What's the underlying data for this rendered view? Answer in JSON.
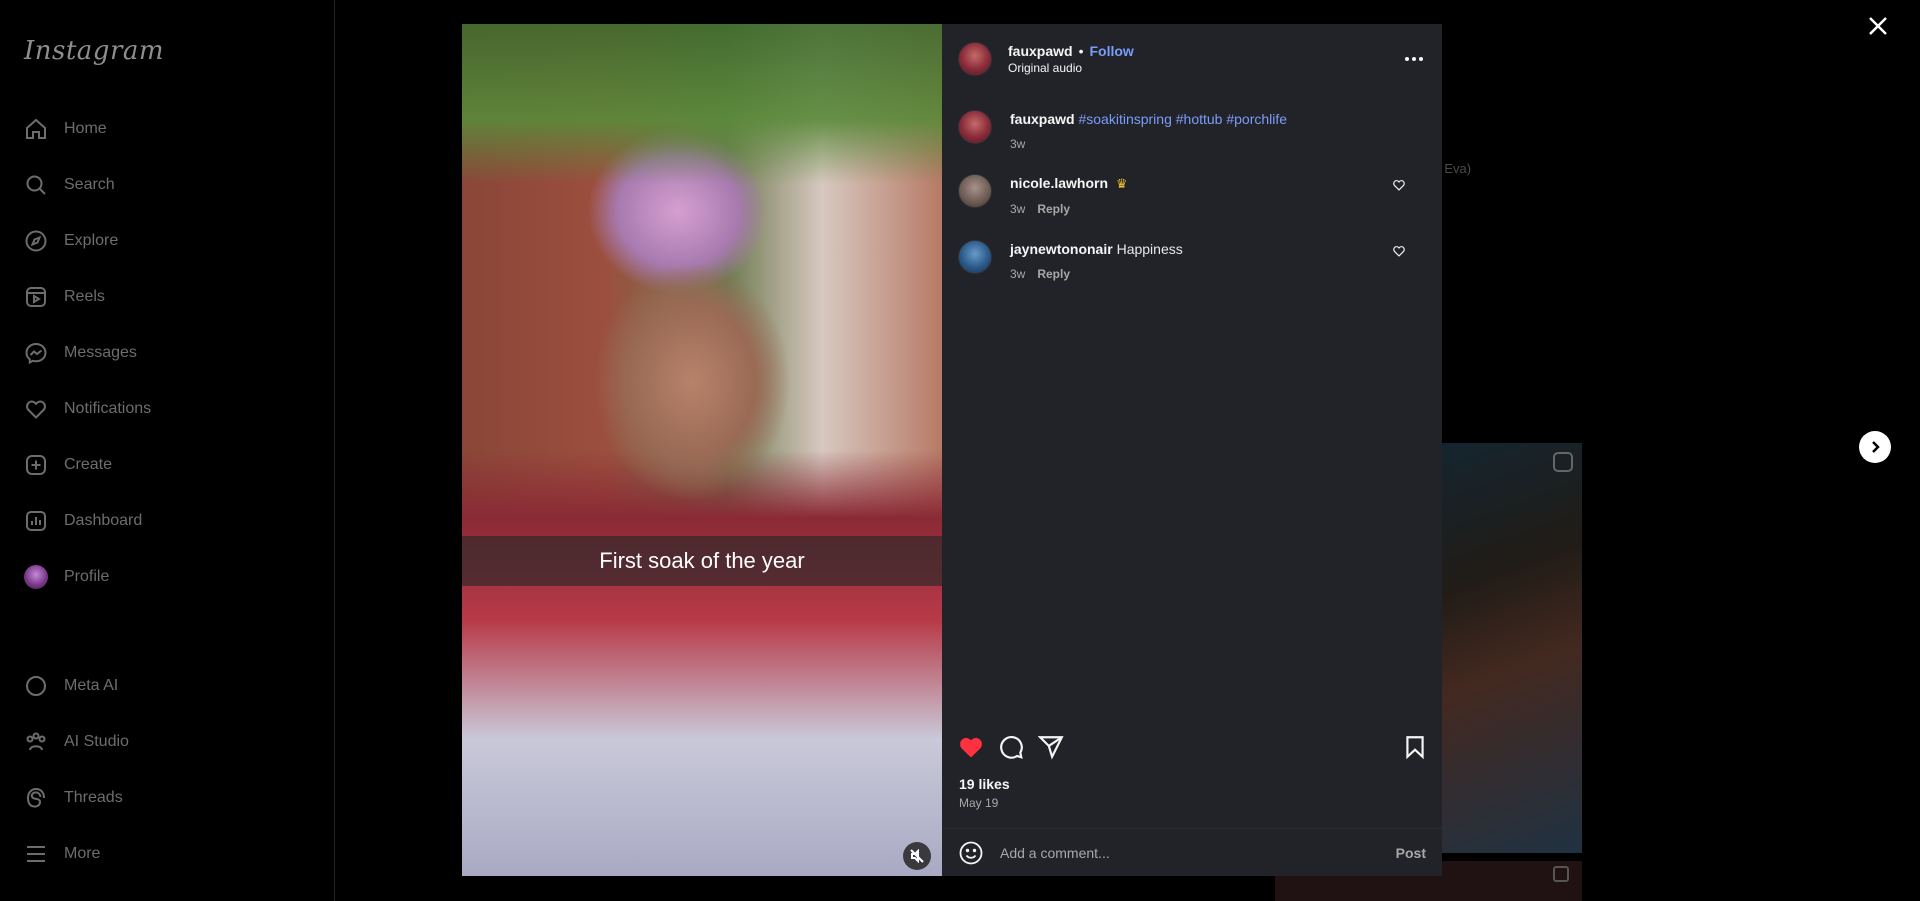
{
  "app": {
    "logo_text": "Instagram"
  },
  "sidebar": {
    "items": [
      {
        "label": "Home",
        "icon": "home-icon"
      },
      {
        "label": "Search",
        "icon": "search-icon"
      },
      {
        "label": "Explore",
        "icon": "compass-icon"
      },
      {
        "label": "Reels",
        "icon": "reels-icon"
      },
      {
        "label": "Messages",
        "icon": "messenger-icon"
      },
      {
        "label": "Notifications",
        "icon": "heart-icon"
      },
      {
        "label": "Create",
        "icon": "plus-square-icon"
      },
      {
        "label": "Dashboard",
        "icon": "chart-icon"
      },
      {
        "label": "Profile",
        "icon": "avatar"
      }
    ],
    "bottom_items": [
      {
        "label": "Meta AI",
        "icon": "ring-icon"
      },
      {
        "label": "AI Studio",
        "icon": "ai-studio-icon"
      },
      {
        "label": "Threads",
        "icon": "threads-icon"
      },
      {
        "label": "More",
        "icon": "menu-icon"
      }
    ]
  },
  "background": {
    "partial_text": "tie Eva)"
  },
  "post": {
    "media": {
      "caption_overlay": "First soak of the year"
    },
    "header": {
      "username": "fauxpawd",
      "separator": "•",
      "follow_label": "Follow",
      "audio": "Original audio"
    },
    "caption": {
      "username": "fauxpawd",
      "hashtags": "#soakitinspring #hottub #porchlife",
      "time": "3w"
    },
    "comments": [
      {
        "username": "nicole.lawhorn",
        "badge": "♛",
        "text": "",
        "time": "3w",
        "reply_label": "Reply"
      },
      {
        "username": "jaynewtononair",
        "text": "Happiness",
        "time": "3w",
        "reply_label": "Reply"
      }
    ],
    "likes": "19 likes",
    "date": "May 19",
    "comment_box": {
      "placeholder": "Add a comment...",
      "post_label": "Post"
    },
    "like_color": "#ff3040"
  }
}
